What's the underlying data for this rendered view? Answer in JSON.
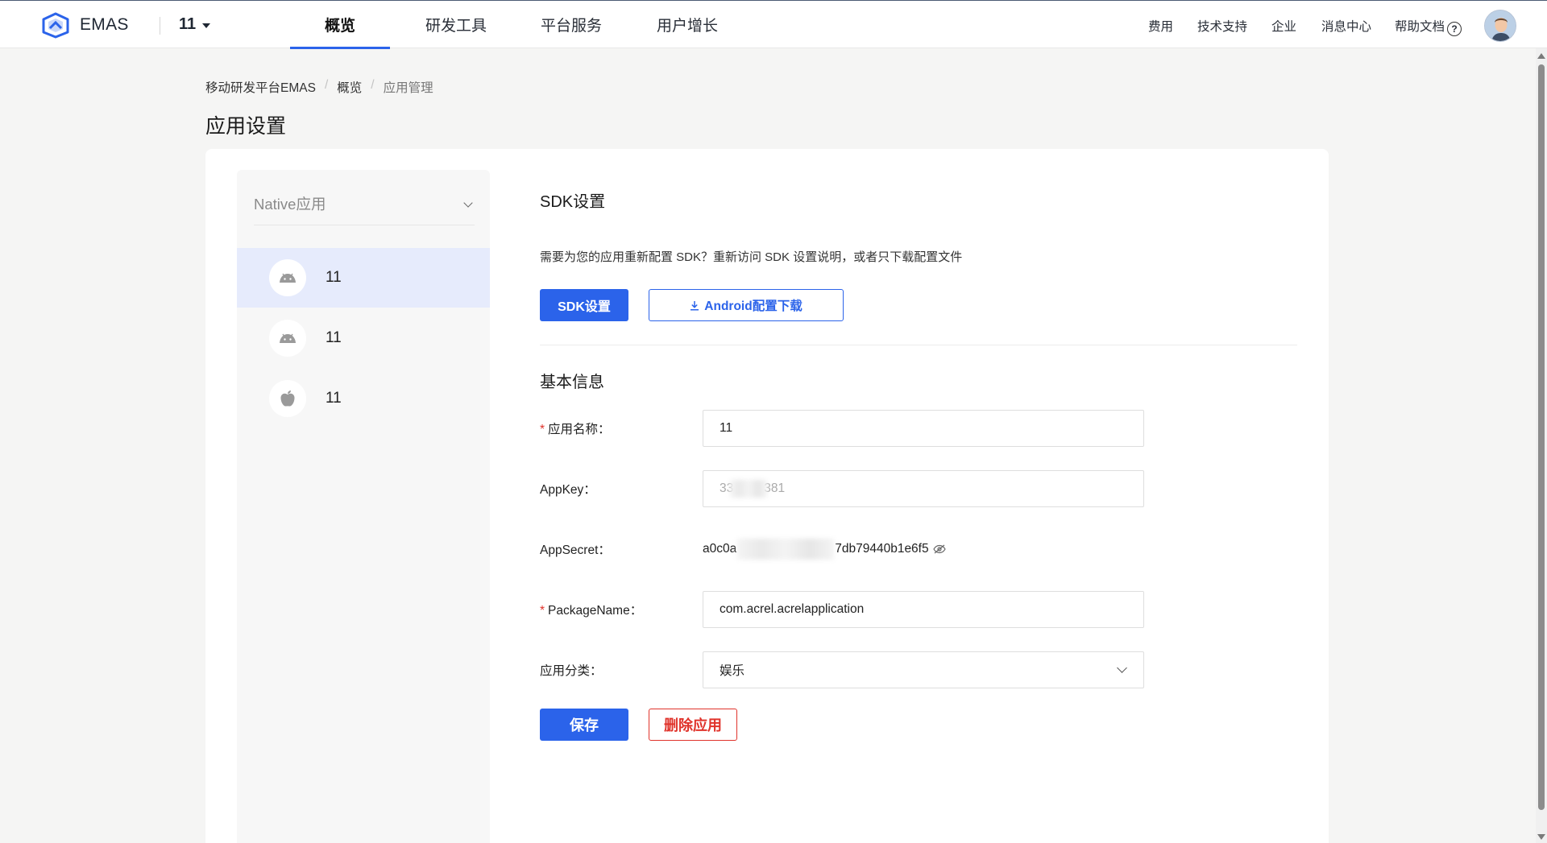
{
  "topbar": {
    "brand": "EMAS",
    "app_switcher": "11",
    "tabs": [
      {
        "label": "概览",
        "active": true
      },
      {
        "label": "研发工具",
        "active": false
      },
      {
        "label": "平台服务",
        "active": false
      },
      {
        "label": "用户增长",
        "active": false
      }
    ],
    "links": {
      "fees": "费用",
      "support": "技术支持",
      "enterprise": "企业",
      "messages": "消息中心",
      "help": "帮助文档",
      "help_icon": "?"
    }
  },
  "breadcrumb": [
    "移动研发平台EMAS",
    "概览",
    "应用管理"
  ],
  "page_title": "应用设置",
  "sidebar": {
    "group_label": "Native应用",
    "apps": [
      {
        "name": "11",
        "platform": "android-icon",
        "selected": true
      },
      {
        "name": "11",
        "platform": "android-icon",
        "selected": false
      },
      {
        "name": "11",
        "platform": "apple-icon",
        "selected": false
      }
    ]
  },
  "sdk": {
    "title": "SDK设置",
    "description": "需要为您的应用重新配置 SDK？重新访问 SDK 设置说明，或者只下载配置文件",
    "settings_button": "SDK设置",
    "download_button": "Android配置下载"
  },
  "basic": {
    "title": "基本信息",
    "app_name_label": "应用名称：",
    "app_name_value": "11",
    "appkey_label": "AppKey：",
    "appkey_prefix": "33",
    "appkey_suffix": "381",
    "appsecret_label": "AppSecret：",
    "appsecret_prefix": "a0c0a",
    "appsecret_suffix": "7db79440b1e6f5",
    "package_label": "PackageName：",
    "package_value": "com.acrel.acrelapplication",
    "category_label": "应用分类：",
    "category_value": "娱乐",
    "save_button": "保存",
    "delete_button": "删除应用"
  },
  "colors": {
    "primary": "#2b63ea",
    "danger": "#e0332b",
    "selected_bg": "#e6ebfc"
  }
}
